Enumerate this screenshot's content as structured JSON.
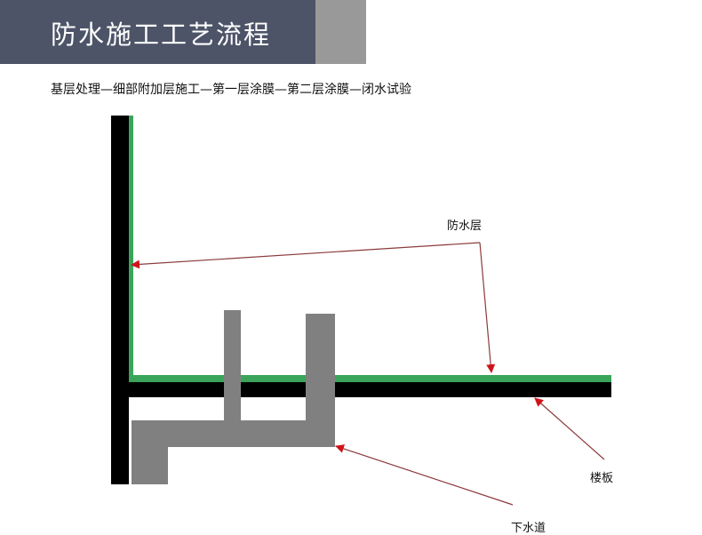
{
  "header": {
    "title": "防水施工工艺流程",
    "process": "基层处理—细部附加层施工—第一层涂膜—第二层涂膜—闭水试验"
  },
  "diagram": {
    "labels": {
      "waterproof_layer": "防水层",
      "floor_slab": "楼板",
      "drain_pipe": "下水道"
    },
    "colors": {
      "title_bg": "#4d5468",
      "accent": "#999999",
      "waterproof_layer": "#3aa55a",
      "slab": "#000000",
      "pipe": "#808080",
      "arrow": "#8b3a3a",
      "arrowhead": "#d0131b"
    }
  }
}
